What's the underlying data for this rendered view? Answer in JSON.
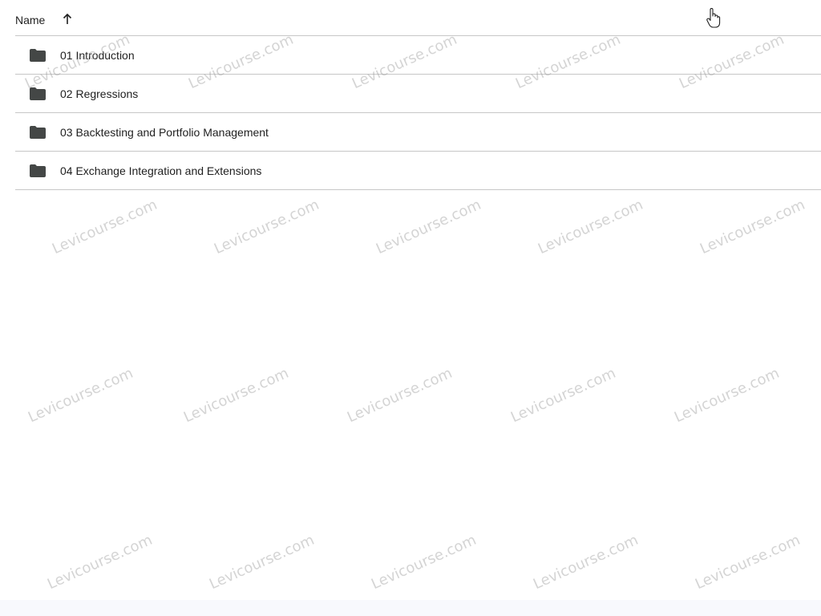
{
  "header": {
    "name_label": "Name",
    "sort_icon": "arrow-up-icon"
  },
  "folders": [
    {
      "label": "01 Introduction",
      "icon": "folder-icon"
    },
    {
      "label": "02 Regressions",
      "icon": "folder-icon"
    },
    {
      "label": "03 Backtesting and Portfolio Management",
      "icon": "folder-icon"
    },
    {
      "label": "04 Exchange Integration and Extensions",
      "icon": "folder-icon"
    }
  ],
  "watermark": {
    "text": "Levicourse.com"
  },
  "colors": {
    "text": "#1f1f1f",
    "icon": "#444746",
    "divider": "#c7c7c7",
    "background": "#ffffff"
  }
}
